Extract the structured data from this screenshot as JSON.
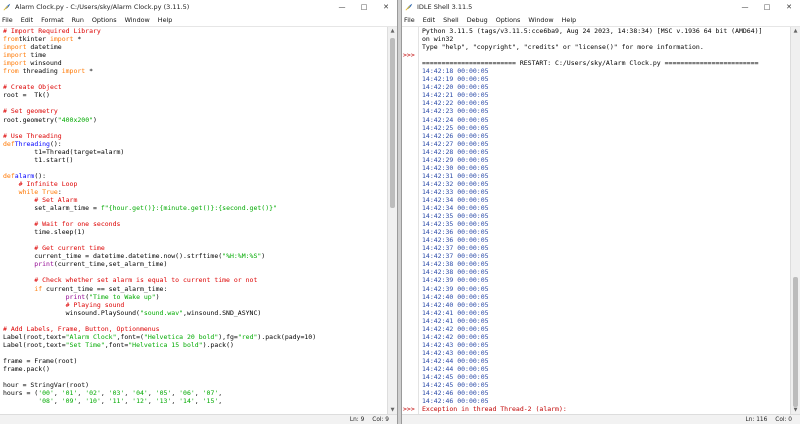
{
  "editor": {
    "title": "Alarm Clock.py - C:/Users/sky/Alarm Clock.py (3.11.5)",
    "menu": [
      "File",
      "Edit",
      "Format",
      "Run",
      "Options",
      "Window",
      "Help"
    ],
    "status": {
      "ln": "Ln: 9",
      "col": "Col: 9"
    },
    "code": [
      [
        [
          "c",
          "# Import Required Library"
        ]
      ],
      [
        [
          "k",
          "from"
        ],
        [
          "",
          "tkinter "
        ],
        [
          "k",
          "import"
        ],
        [
          "",
          " *"
        ]
      ],
      [
        [
          "k",
          "import"
        ],
        [
          "",
          " datetime"
        ]
      ],
      [
        [
          "k",
          "import"
        ],
        [
          "",
          " time"
        ]
      ],
      [
        [
          "k",
          "import"
        ],
        [
          "",
          " winsound"
        ]
      ],
      [
        [
          "k",
          "from"
        ],
        [
          "",
          " threading "
        ],
        [
          "k",
          "import"
        ],
        [
          "",
          " *"
        ]
      ],
      [
        [
          "",
          ""
        ]
      ],
      [
        [
          "c",
          "# Create Object"
        ]
      ],
      [
        [
          "",
          "root =  Tk()"
        ]
      ],
      [
        [
          "",
          ""
        ]
      ],
      [
        [
          "c",
          "# Set geometry"
        ]
      ],
      [
        [
          "",
          "root.geometry("
        ],
        [
          "s",
          "\"400x200\""
        ],
        [
          "",
          ")"
        ]
      ],
      [
        [
          "",
          ""
        ]
      ],
      [
        [
          "c",
          "# Use Threading"
        ]
      ],
      [
        [
          "k",
          "def"
        ],
        [
          " ",
          ""
        ],
        [
          "d",
          "Threading"
        ],
        [
          "",
          "():"
        ]
      ],
      [
        [
          "",
          "        t1=Thread(target=alarm)"
        ]
      ],
      [
        [
          "",
          "        t1.start()"
        ]
      ],
      [
        [
          "",
          ""
        ]
      ],
      [
        [
          "k",
          "def"
        ],
        [
          " ",
          ""
        ],
        [
          "d",
          "alarm"
        ],
        [
          "",
          "():"
        ]
      ],
      [
        [
          "c",
          "    # Infinite Loop"
        ]
      ],
      [
        [
          "k",
          "    while"
        ],
        [
          "",
          " "
        ],
        [
          "k",
          "True"
        ],
        [
          "",
          ":"
        ]
      ],
      [
        [
          "c",
          "        # Set Alarm"
        ]
      ],
      [
        [
          "",
          "        set_alarm_time = "
        ],
        [
          "s",
          "f\"{hour.get()}:{minute.get()}:{second.get()}\""
        ]
      ],
      [
        [
          "",
          ""
        ]
      ],
      [
        [
          "c",
          "        # Wait for one seconds"
        ]
      ],
      [
        [
          "",
          "        time.sleep(1)"
        ]
      ],
      [
        [
          "",
          ""
        ]
      ],
      [
        [
          "c",
          "        # Get current time"
        ]
      ],
      [
        [
          "",
          "        current_time = datetime.datetime.now().strftime("
        ],
        [
          "s",
          "\"%H:%M:%S\""
        ],
        [
          "",
          ")"
        ]
      ],
      [
        [
          "b",
          "        print"
        ],
        [
          "",
          "(current_time,set_alarm_time)"
        ]
      ],
      [
        [
          "",
          ""
        ]
      ],
      [
        [
          "c",
          "        # Check whether set alarm is equal to current time or not"
        ]
      ],
      [
        [
          "k",
          "        if"
        ],
        [
          "",
          " current_time == set_alarm_time:"
        ]
      ],
      [
        [
          "b",
          "                print"
        ],
        [
          "",
          "("
        ],
        [
          "s",
          "\"Time to Wake up\""
        ],
        [
          "",
          ")"
        ]
      ],
      [
        [
          "c",
          "                # Playing sound"
        ]
      ],
      [
        [
          "",
          "                winsound.PlaySound("
        ],
        [
          "s",
          "\"sound.wav\""
        ],
        [
          "",
          ",winsound.SND_ASYNC)"
        ]
      ],
      [
        [
          "",
          ""
        ]
      ],
      [
        [
          "c",
          "# Add Labels, Frame, Button, Optionmenus"
        ]
      ],
      [
        [
          "",
          "Label(root,text="
        ],
        [
          "s",
          "\"Alarm Clock\""
        ],
        [
          "",
          ",font=("
        ],
        [
          "s",
          "\"Helvetica 20 bold\""
        ],
        [
          "",
          "),fg="
        ],
        [
          "s",
          "\"red\""
        ],
        [
          "",
          ").pack(pady=10)"
        ]
      ],
      [
        [
          "",
          "Label(root,text="
        ],
        [
          "s",
          "\"Set Time\""
        ],
        [
          "",
          ",font="
        ],
        [
          "s",
          "\"Helvetica 15 bold\""
        ],
        [
          "",
          ").pack()"
        ]
      ],
      [
        [
          "",
          ""
        ]
      ],
      [
        [
          "",
          "frame = Frame(root)"
        ]
      ],
      [
        [
          "",
          "frame.pack()"
        ]
      ],
      [
        [
          "",
          ""
        ]
      ],
      [
        [
          "",
          "hour = StringVar(root)"
        ]
      ],
      [
        [
          "",
          "hours = ("
        ],
        [
          "s",
          "'00'"
        ],
        [
          "",
          ", "
        ],
        [
          "s",
          "'01'"
        ],
        [
          "",
          ", "
        ],
        [
          "s",
          "'02'"
        ],
        [
          "",
          ", "
        ],
        [
          "s",
          "'03'"
        ],
        [
          "",
          ", "
        ],
        [
          "s",
          "'04'"
        ],
        [
          "",
          ", "
        ],
        [
          "s",
          "'05'"
        ],
        [
          "",
          ", "
        ],
        [
          "s",
          "'06'"
        ],
        [
          "",
          ", "
        ],
        [
          "s",
          "'07'"
        ],
        [
          "",
          ","
        ]
      ],
      [
        [
          "",
          "         "
        ],
        [
          "s",
          "'08'"
        ],
        [
          "",
          ", "
        ],
        [
          "s",
          "'09'"
        ],
        [
          "",
          ", "
        ],
        [
          "s",
          "'10'"
        ],
        [
          "",
          ", "
        ],
        [
          "s",
          "'11'"
        ],
        [
          "",
          ", "
        ],
        [
          "s",
          "'12'"
        ],
        [
          "",
          ", "
        ],
        [
          "s",
          "'13'"
        ],
        [
          "",
          ", "
        ],
        [
          "s",
          "'14'"
        ],
        [
          "",
          ", "
        ],
        [
          "s",
          "'15'"
        ],
        [
          "",
          ","
        ]
      ]
    ]
  },
  "shell": {
    "title": "IDLE Shell 3.11.5",
    "menu": [
      "File",
      "Edit",
      "Shell",
      "Debug",
      "Options",
      "Window",
      "Help"
    ],
    "status": {
      "ln": "Ln: 116",
      "col": "Col: 0"
    },
    "header": [
      "Python 3.11.5 (tags/v3.11.5:cce6ba9, Aug 24 2023, 14:38:34) [MSC v.1936 64 bit (AMD64)]",
      "on win32",
      "Type \"help\", \"copyright\", \"credits\" or \"license()\" for more information.",
      "",
      "======================== RESTART: C:/Users/sky/Alarm Clock.py ========================"
    ],
    "prompt": ">>>",
    "output": [
      "14:42:18 00:00:05",
      "14:42:19 00:00:05",
      "14:42:20 00:00:05",
      "14:42:21 00:00:05",
      "14:42:22 00:00:05",
      "14:42:23 00:00:05",
      "14:42:24 00:00:05",
      "14:42:25 00:00:05",
      "14:42:26 00:00:05",
      "14:42:27 00:00:05",
      "14:42:28 00:00:05",
      "14:42:29 00:00:05",
      "14:42:30 00:00:05",
      "14:42:31 00:00:05",
      "14:42:32 00:00:05",
      "14:42:33 00:00:05",
      "14:42:34 00:00:05",
      "14:42:34 00:00:05",
      "14:42:35 00:00:05",
      "14:42:35 00:00:05",
      "14:42:36 00:00:05",
      "14:42:36 00:00:05",
      "14:42:37 00:00:05",
      "14:42:37 00:00:05",
      "14:42:38 00:00:05",
      "14:42:38 00:00:05",
      "14:42:39 00:00:05",
      "14:42:39 00:00:05",
      "14:42:40 00:00:05",
      "14:42:40 00:00:05",
      "14:42:41 00:00:05",
      "14:42:41 00:00:05",
      "14:42:42 00:00:05",
      "14:42:42 00:00:05",
      "14:42:43 00:00:05",
      "14:42:43 00:00:05",
      "14:42:44 00:00:05",
      "14:42:44 00:00:05",
      "14:42:45 00:00:05",
      "14:42:45 00:00:05",
      "14:42:46 00:00:05",
      "14:42:46 00:00:05"
    ],
    "error": "Exception in thread Thread-2 (alarm):"
  }
}
